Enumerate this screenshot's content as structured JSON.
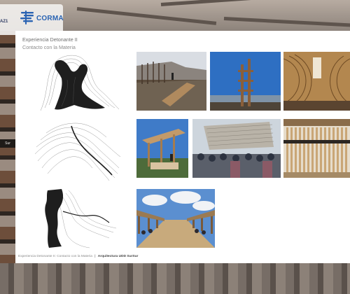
{
  "logos": {
    "left_partial": "AZ1",
    "corma": "CORMA"
  },
  "left_strip": {
    "partial_label": "Sur"
  },
  "slide": {
    "title": "Experiencia Detonante II",
    "subtitle": "Contacto con la Materia",
    "footer_text": "Experiencia Detonante II: Contacto con la Materia",
    "footer_separator": "|",
    "footer_credit": "Arquitectura UDD SurSur"
  },
  "colors": {
    "corma_blue": "#2a63b2",
    "slide_bg": "#ffffff",
    "frame_bg": "#6b625c"
  },
  "drawings": [
    {
      "name": "tree-trunk-contour-drawing"
    },
    {
      "name": "topographic-contour-drawing"
    },
    {
      "name": "vertical-mass-contour-drawing"
    }
  ],
  "photos": [
    {
      "name": "photo-wooden-frames-field"
    },
    {
      "name": "photo-timber-tower-sky"
    },
    {
      "name": "photo-curved-wood-interior"
    },
    {
      "name": "photo-wooden-pavilion-construction"
    },
    {
      "name": "photo-students-group-wood-canopy"
    },
    {
      "name": "photo-vertical-slats-screen"
    },
    {
      "name": "photo-outdoor-corridor-exhibition"
    }
  ]
}
